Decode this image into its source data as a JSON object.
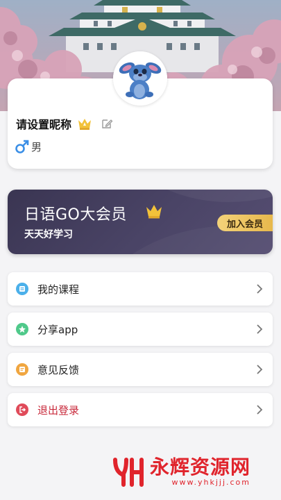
{
  "profile": {
    "nickname": "请设置昵称",
    "gender": "男",
    "icons": {
      "crown": "crown-icon",
      "edit": "edit-icon",
      "gender": "male-icon"
    }
  },
  "vip": {
    "title": "日语GO大会员",
    "subtitle": "天天好学习",
    "join_label": "加入会员"
  },
  "menu": [
    {
      "label": "我的课程",
      "icon": "course-icon",
      "color": "#4bb0ea"
    },
    {
      "label": "分享app",
      "icon": "share-icon",
      "color": "#4fc98a"
    },
    {
      "label": "意见反馈",
      "icon": "feedback-icon",
      "color": "#f0a640"
    },
    {
      "label": "退出登录",
      "icon": "logout-icon",
      "color": "#e04b5a"
    }
  ],
  "watermark": {
    "title": "永辉资源网",
    "url": "www.yhkjjj.com"
  },
  "colors": {
    "accent_gold": "#e7b84c",
    "vip_bg": "#3a3552",
    "logout_red": "#c8283a"
  }
}
